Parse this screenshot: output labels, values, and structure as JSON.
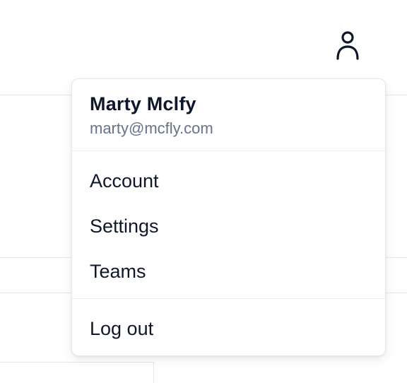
{
  "header": {
    "user_icon": "user-icon"
  },
  "dropdown": {
    "user_name": "Marty Mclfy",
    "user_email": "marty@mcfly.com",
    "items": [
      {
        "label": "Account"
      },
      {
        "label": "Settings"
      },
      {
        "label": "Teams"
      }
    ],
    "logout_label": "Log out"
  },
  "colors": {
    "text_primary": "#0f172a",
    "text_secondary": "#64748b",
    "border": "#e5e7eb"
  }
}
